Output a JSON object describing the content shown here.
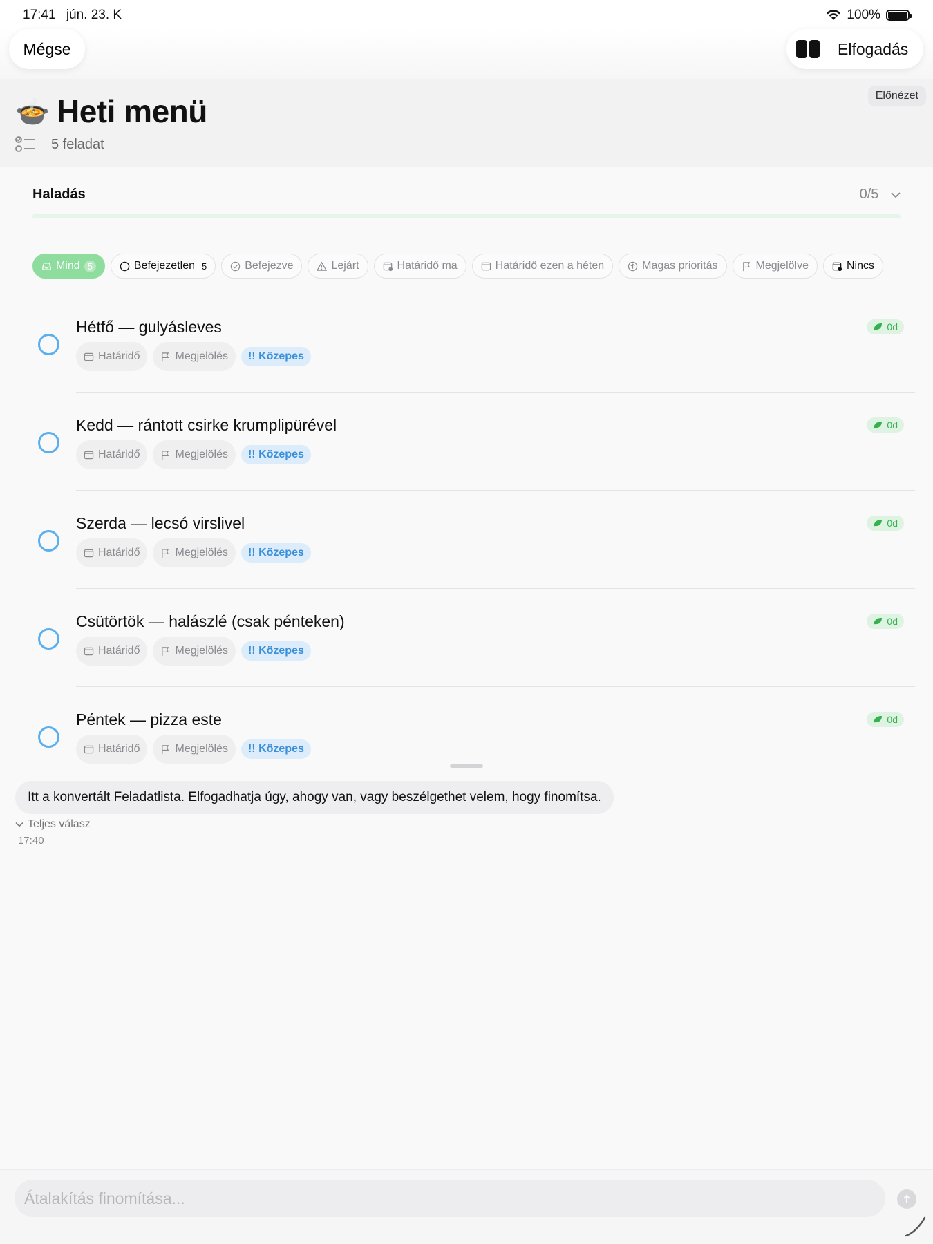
{
  "status_bar": {
    "time": "17:41",
    "date": "jún. 23. K",
    "battery": "100%"
  },
  "nav": {
    "cancel_label": "Mégse",
    "accept_label": "Elfogadás"
  },
  "header": {
    "preview_label": "Előnézet",
    "title": "Heti menü",
    "task_count": "5 feladat"
  },
  "progress": {
    "label": "Haladás",
    "count": "0/5",
    "fraction": 0
  },
  "filters": [
    {
      "label": "Mind",
      "count": "5"
    },
    {
      "label": "Befejezetlen",
      "count": "5"
    },
    {
      "label": "Befejezve"
    },
    {
      "label": "Lejárt"
    },
    {
      "label": "Határidő ma"
    },
    {
      "label": "Határidő ezen a héten"
    },
    {
      "label": "Magas prioritás"
    },
    {
      "label": "Megjelölve"
    },
    {
      "label": "Nincs"
    }
  ],
  "tasks": [
    {
      "title": "Hétfő — gulyásleves",
      "due_label": "Határidő",
      "flag_label": "Megjelölés",
      "priority": "!! Közepes",
      "age": "0d"
    },
    {
      "title": "Kedd — rántott csirke krumplipürével",
      "due_label": "Határidő",
      "flag_label": "Megjelölés",
      "priority": "!! Közepes",
      "age": "0d"
    },
    {
      "title": "Szerda — lecsó virslivel",
      "due_label": "Határidő",
      "flag_label": "Megjelölés",
      "priority": "!! Közepes",
      "age": "0d"
    },
    {
      "title": "Csütörtök — halászlé (csak pénteken)",
      "due_label": "Határidő",
      "flag_label": "Megjelölés",
      "priority": "!! Közepes",
      "age": "0d"
    },
    {
      "title": "Péntek — pizza este",
      "due_label": "Határidő",
      "flag_label": "Megjelölés",
      "priority": "!! Közepes",
      "age": "0d"
    }
  ],
  "chat": {
    "message": "Itt a konvertált Feladatlista. Elfogadhatja úgy, ahogy van, vagy beszélgethet velem, hogy finomítsa.",
    "full_answer_label": "Teljes válasz",
    "timestamp": "17:40"
  },
  "composer": {
    "placeholder": "Átalakítás finomítása..."
  },
  "colors": {
    "accent_green": "#34c759",
    "circle_blue": "#5ab0ef",
    "priority_blue": "#3a8fd9"
  }
}
